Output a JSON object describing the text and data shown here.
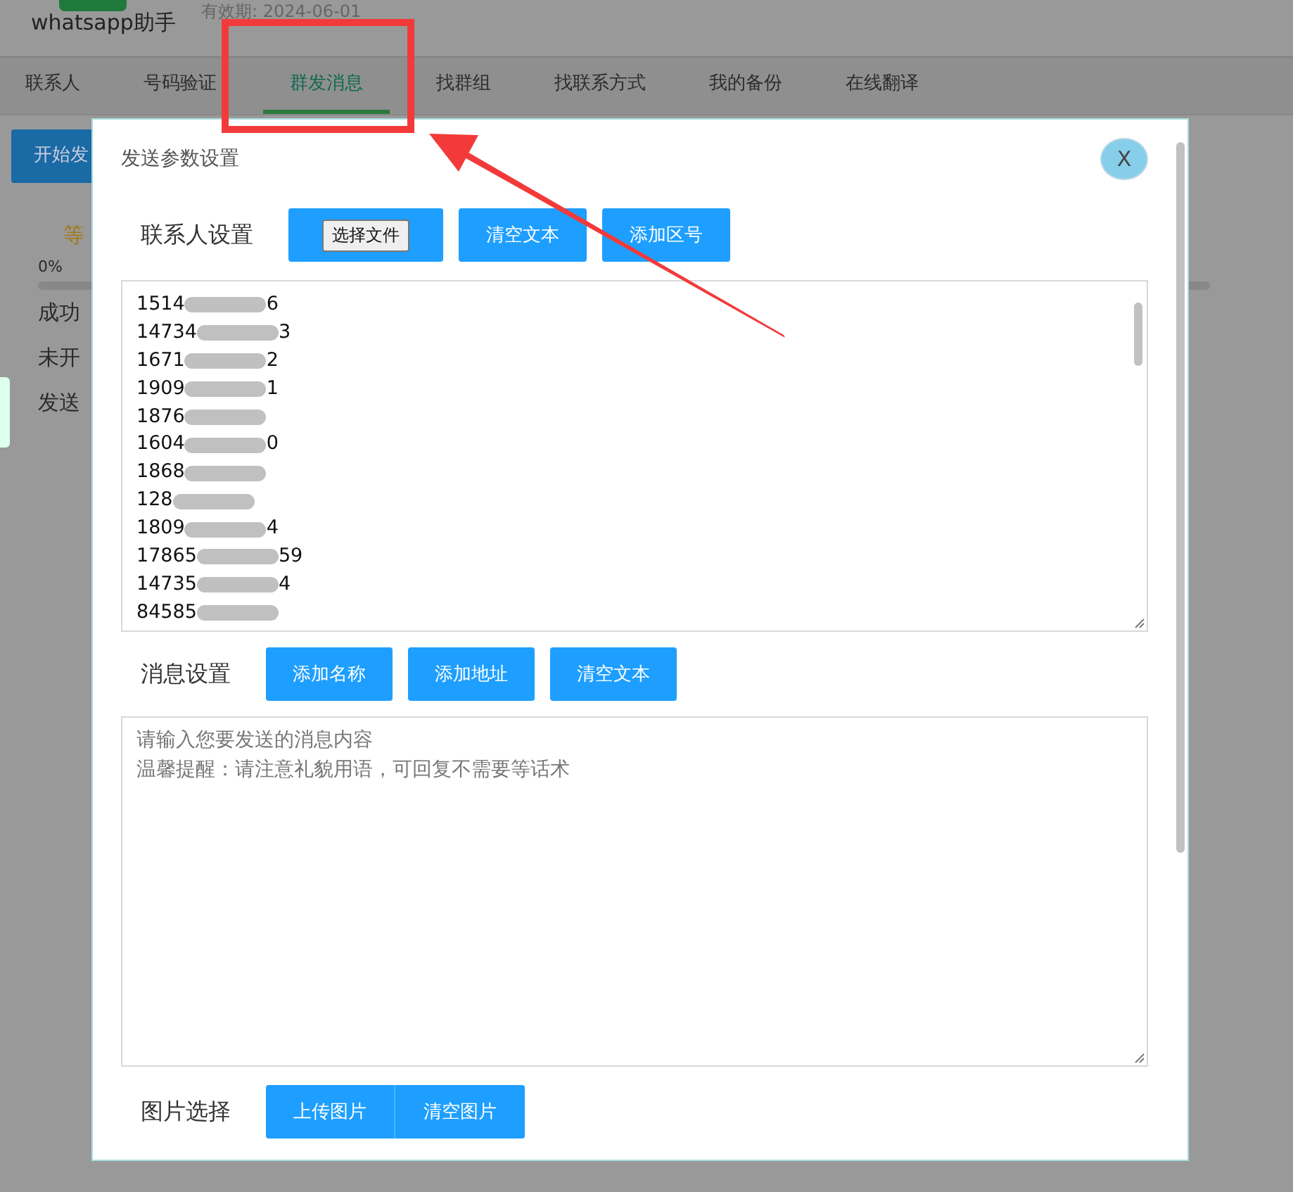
{
  "app": {
    "name": "whatsapp助手",
    "expiry": "有效期: 2024-06-01"
  },
  "tabs": [
    {
      "label": "联系人",
      "selected": false
    },
    {
      "label": "号码验证",
      "selected": false
    },
    {
      "label": "群发消息",
      "selected": true
    },
    {
      "label": "找群组",
      "selected": false
    },
    {
      "label": "找联系方式",
      "selected": false
    },
    {
      "label": "我的备份",
      "selected": false
    },
    {
      "label": "在线翻译",
      "selected": false
    }
  ],
  "background": {
    "start_button": "开始发",
    "status": "等",
    "progress_reading": "0%",
    "lines": [
      "成功",
      "未开",
      "发送"
    ]
  },
  "dialog": {
    "title": "发送参数设置",
    "close": "X",
    "contacts": {
      "label": "联系人设置",
      "file_button": "选择文件",
      "buttons": [
        "清空文本",
        "添加区号"
      ],
      "numbers": [
        {
          "head": "1514",
          "tail": "6"
        },
        {
          "head": "14734",
          "tail": "3"
        },
        {
          "head": "1671",
          "tail": "2"
        },
        {
          "head": "1909",
          "tail": "1"
        },
        {
          "head": "1876"
        },
        {
          "head": "1604",
          "tail": "0"
        },
        {
          "head": "1868"
        },
        {
          "head": "128"
        },
        {
          "head": "1809",
          "tail": "4"
        },
        {
          "head": "17865",
          "tail": "59"
        },
        {
          "head": "14735",
          "tail": "4"
        },
        {
          "head": "84585"
        }
      ]
    },
    "message": {
      "label": "消息设置",
      "buttons": [
        "添加名称",
        "添加地址",
        "清空文本"
      ],
      "placeholder": [
        "请输入您要发送的消息内容",
        "温馨提醒：请注意礼貌用语，可回复不需要等话术"
      ]
    },
    "images": {
      "label": "图片选择",
      "buttons": [
        "上传图片",
        "清空图片"
      ]
    }
  }
}
